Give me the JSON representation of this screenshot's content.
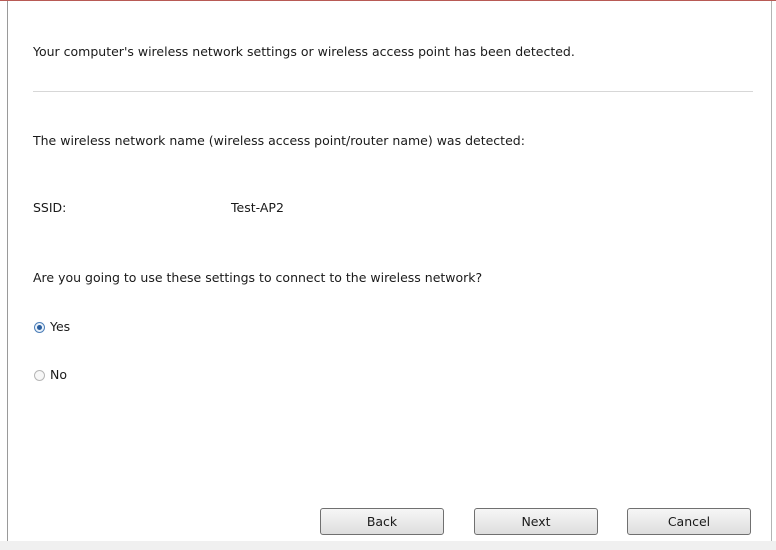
{
  "wizard": {
    "detected_message": "Your computer's wireless network settings or wireless access point has been detected.",
    "network_name_message": "The wireless network name (wireless access point/router name) was detected:",
    "ssid_label": "SSID:",
    "ssid_value": "Test-AP2",
    "question": "Are you going to use these settings to connect to the wireless network?",
    "options": [
      {
        "label": "Yes",
        "selected": true
      },
      {
        "label": "No",
        "selected": false
      }
    ]
  },
  "buttons": {
    "back": "Back",
    "next": "Next",
    "cancel": "Cancel"
  }
}
